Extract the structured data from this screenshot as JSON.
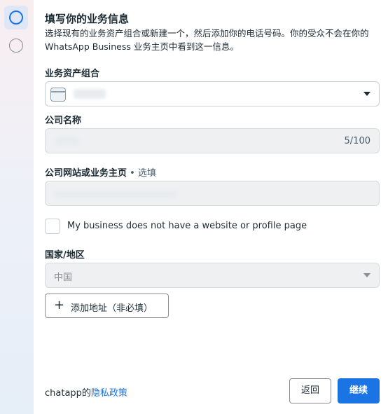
{
  "steps": [
    {
      "state": "active"
    },
    {
      "state": "inactive"
    }
  ],
  "form": {
    "title": "填写你的业务信息",
    "description": "选择现有的业务资产组合或新建一个，然后添加你的电话号码。你的受众不会在你的 WhatsApp Business 业务主页中看到这一信息。",
    "portfolio": {
      "label": "业务资产组合",
      "value": ""
    },
    "company_name": {
      "label": "公司名称",
      "value": "",
      "counter": "5/100"
    },
    "website": {
      "label": "公司网站或业务主页",
      "optional": " • 选填",
      "value": ""
    },
    "no_website": {
      "label": "My business does not have a website or profile page",
      "checked": false
    },
    "country": {
      "label": "国家/地区",
      "value": "中国"
    },
    "add_address": {
      "icon": "plus-icon",
      "label": "添加地址（非必填）"
    }
  },
  "footer": {
    "prefix": "chatapp的",
    "privacy_link": "隐私政策",
    "back_label": "返回",
    "next_label": "继续"
  },
  "colors": {
    "accent": "#1b74e4",
    "text": "#1c2b33",
    "disabled_bg": "#eef0f2"
  }
}
